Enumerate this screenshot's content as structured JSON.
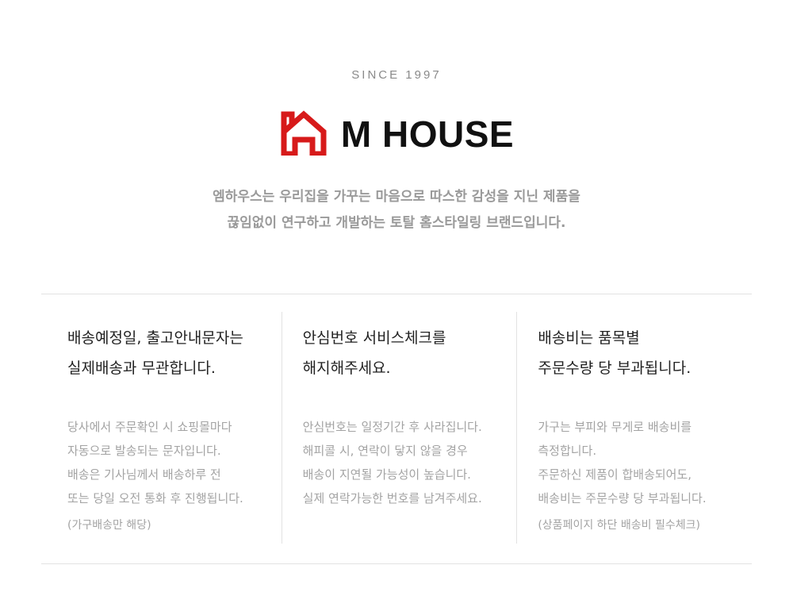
{
  "header": {
    "since": "SINCE 1997",
    "brand": "M HOUSE",
    "logo_icon": "house-outline-icon",
    "brand_color": "#d71a1a",
    "tagline": [
      "엠하우스는 우리집을 가꾸는 마음으로 따스한 감성을 지닌 제품을",
      "끊임없이 연구하고 개발하는 토탈 홈스타일링 브랜드입니다."
    ]
  },
  "info": [
    {
      "title": [
        "배송예정일, 출고안내문자는",
        "실제배송과 무관합니다."
      ],
      "body": [
        "당사에서 주문확인 시 쇼핑몰마다",
        "자동으로 발송되는 문자입니다.",
        "배송은 기사님께서 배송하루 전",
        "또는 당일 오전 통화 후 진행됩니다."
      ],
      "note": "(가구배송만 해당)"
    },
    {
      "title": [
        "안심번호 서비스체크를",
        "해지해주세요."
      ],
      "body": [
        "안심번호는 일정기간 후 사라집니다.",
        "해피콜 시, 연락이 닿지 않을 경우",
        "배송이 지연될 가능성이 높습니다.",
        "실제 연락가능한 번호를 남겨주세요."
      ],
      "note": ""
    },
    {
      "title": [
        "배송비는 품목별",
        "주문수량 당 부과됩니다."
      ],
      "body": [
        "가구는 부피와 무게로 배송비를",
        "측정합니다.",
        "주문하신 제품이 합배송되어도,",
        "배송비는 주문수량 당 부과됩니다."
      ],
      "note": "(상품페이지 하단 배송비 필수체크)"
    }
  ]
}
